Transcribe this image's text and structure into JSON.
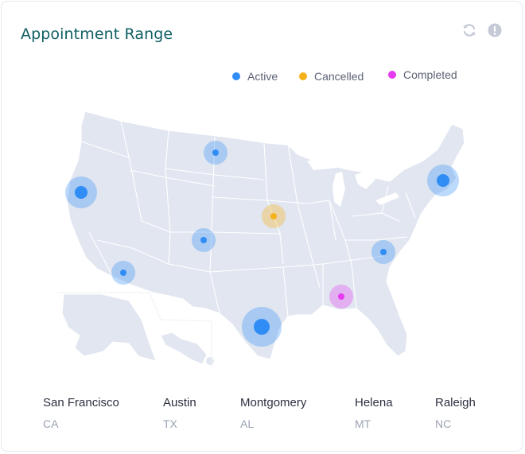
{
  "header": {
    "title": "Appointment Range",
    "refresh_icon": "refresh-icon",
    "info_icon": "alert-circle-icon"
  },
  "legend": [
    {
      "label": "Active",
      "color": "#2f8df5"
    },
    {
      "label": "Cancelled",
      "color": "#f5b11c"
    },
    {
      "label": "Completed",
      "color": "#e63af0"
    }
  ],
  "map": {
    "land_color": "#e1e6f0",
    "markers": [
      {
        "status": "active",
        "size": "large"
      },
      {
        "status": "active",
        "size": "medium"
      },
      {
        "status": "active",
        "size": "medium"
      },
      {
        "status": "active",
        "size": "medium"
      },
      {
        "status": "cancelled",
        "size": "medium"
      },
      {
        "status": "active",
        "size": "large"
      },
      {
        "status": "active",
        "size": "medium"
      },
      {
        "status": "active",
        "size": "xlarge"
      },
      {
        "status": "completed",
        "size": "medium"
      }
    ]
  },
  "cities": [
    {
      "name": "San Francisco",
      "state": "CA"
    },
    {
      "name": "Austin",
      "state": "TX"
    },
    {
      "name": "Montgomery",
      "state": "AL"
    },
    {
      "name": "Helena",
      "state": "MT"
    },
    {
      "name": "Raleigh",
      "state": "NC"
    }
  ]
}
